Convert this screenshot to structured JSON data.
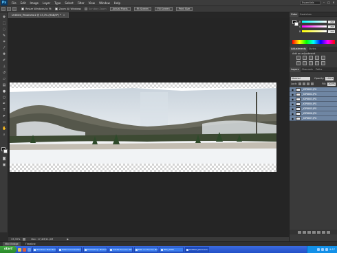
{
  "menubar": {
    "logo": "Ps",
    "items": [
      "File",
      "Edit",
      "Image",
      "Layer",
      "Type",
      "Select",
      "Filter",
      "View",
      "Window",
      "Help"
    ],
    "workspace": "Essentials"
  },
  "options": {
    "resize_windows": "Resize Windows to Fit",
    "zoom_all": "Zoom All Windows",
    "scrubby_zoom": "Scrubby Zoom",
    "actual_pixels": "Actual Pixels",
    "fit_screen": "Fit Screen",
    "fill_screen": "Fill Screen",
    "print_size": "Print Size"
  },
  "document": {
    "tab_title": "Untitled_Panorama1 @ 33,3% (RGB/8*) *",
    "zoom": "33,33%",
    "doc_size": "Doc: 17,4M/11,0M"
  },
  "panels": {
    "color_tabs": [
      "Color",
      "Swatches"
    ],
    "rgb": [
      {
        "label": "R",
        "value": "255"
      },
      {
        "label": "G",
        "value": "255"
      },
      {
        "label": "B",
        "value": "255"
      }
    ],
    "adjust_tabs": [
      "Adjustments",
      "Styles"
    ],
    "add_adjustment": "Add an adjustment",
    "layers_tabs": [
      "Layers",
      "Channels",
      "Paths"
    ],
    "blend_mode": "Normal",
    "opacity_label": "Opacity:",
    "opacity": "100%",
    "lock_label": "Lock:",
    "fill_label": "Fill:",
    "fill": "100%",
    "layers": [
      {
        "name": "_IGP8801.JPG"
      },
      {
        "name": "_IGP8802.JPG"
      },
      {
        "name": "_IGP8803.JPG"
      },
      {
        "name": "_IGP8804.JPG"
      },
      {
        "name": "_IGP8805.JPG"
      },
      {
        "name": "_IGP8806.JPG"
      },
      {
        "name": "_IGP8807.JPG"
      }
    ]
  },
  "minibridge": {
    "tabs": [
      "Mini Bridge",
      "Timeline"
    ]
  },
  "taskbar": {
    "start": "start",
    "tasks": [
      {
        "label": "Windows Task Manager"
      },
      {
        "label": "Total Commander 8.0..."
      },
      {
        "label": "Photoshop: Photome..."
      },
      {
        "label": "Adobe Forums: Pho..."
      },
      {
        "label": "Mail on the Fox Mail..."
      },
      {
        "label": "IMG_0065"
      },
      {
        "label": "Untitled_Panoram..."
      }
    ],
    "clock": "9:57"
  }
}
